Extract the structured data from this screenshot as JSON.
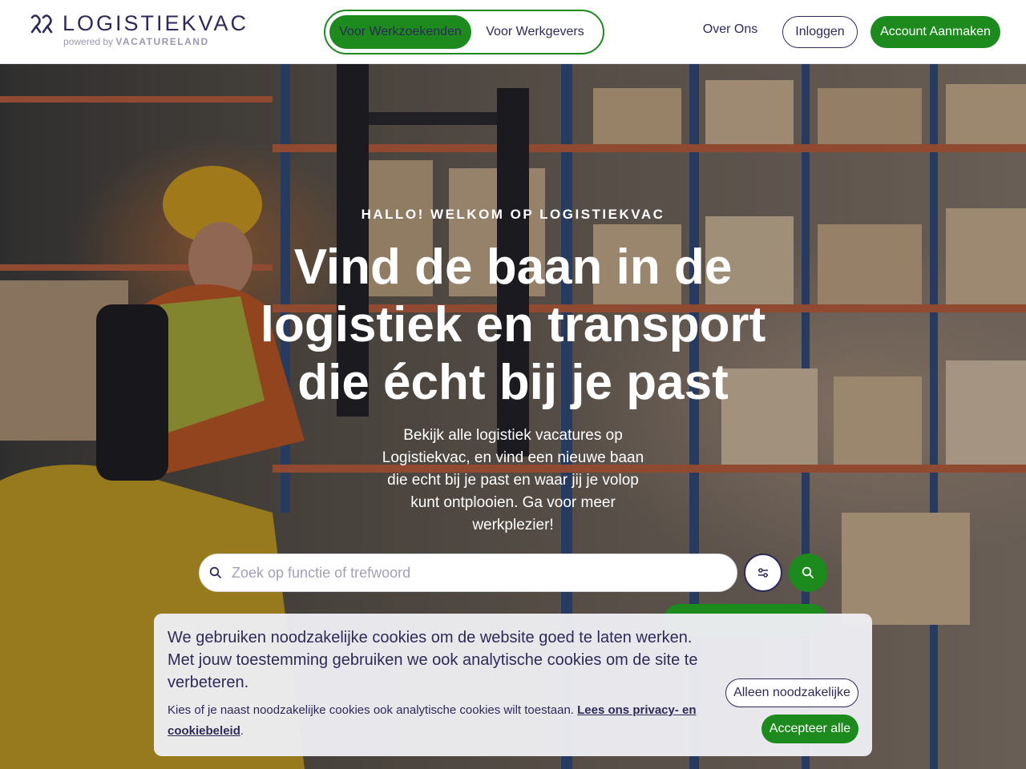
{
  "header": {
    "logo_text": "LOGISTIEKVAC",
    "logo_powered_prefix": "powered by",
    "logo_powered_brand": "VACATURELAND",
    "audience_toggle": [
      "Voor Werkzoekenden",
      "Voor Werkgevers"
    ],
    "active_audience": "Voor Werkzoekenden",
    "nav_about": "Over Ons",
    "login_label": "Inloggen",
    "signup_label": "Account Aanmaken"
  },
  "hero": {
    "kicker": "HALLO! WELKOM OP LOGISTIEKVAC",
    "title": "Vind de baan in de logistiek en transport die écht bij je past",
    "text": "Bekijk alle logistiek vacatures op Logistiekvac, en vind een nieuwe baan die echt bij je past en waar jij je volop kunt ontplooien. Ga voor meer werkplezier!",
    "background_image_icon": "warehouse-forklift-photo"
  },
  "search": {
    "placeholder": "Zoek op functie of trefwoord",
    "value": "",
    "search_icon": "search-icon",
    "filter_icon": "filter-sliders-icon",
    "submit_icon": "search-icon"
  },
  "cookie_banner": {
    "message": "We gebruiken noodzakelijke cookies om de website goed te laten werken. Met jouw toestemming gebruiken we ook analytische cookies om de site te verbeteren.",
    "sub_message": "Kies of je naast noodzakelijke cookies ook analytische cookies wilt toestaan.",
    "link_label": "Lees ons privacy- en cookiebeleid",
    "sub_suffix": ".",
    "necessary_label": "Alleen noodzakelijke",
    "accept_label": "Accepteer alle"
  },
  "colors": {
    "primary_green": "#1c8a1c",
    "navy": "#2d2a5a",
    "banner_bg": "#eeeef3"
  }
}
